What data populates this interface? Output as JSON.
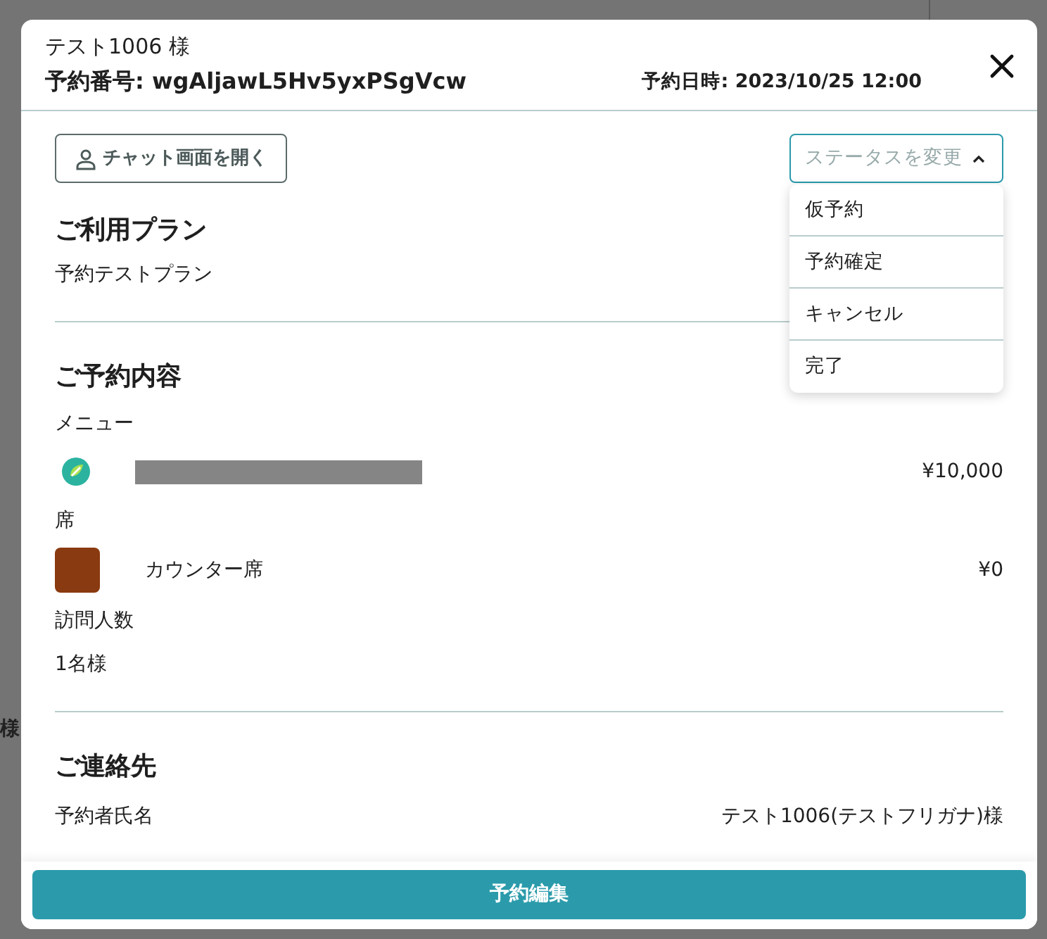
{
  "background": {
    "row_fragment": "様"
  },
  "modal": {
    "customer": "テスト1006 様",
    "reservation_number": "予約番号: wgAljawL5Hv5yxPSgVcw",
    "reservation_datetime": "予約日時: 2023/10/25 12:00"
  },
  "chat_button": "チャット画面を開く",
  "status_select": {
    "placeholder": "ステータスを変更",
    "expanded": true,
    "options": [
      {
        "label": "仮予約",
        "selected": false
      },
      {
        "label": "予約確定",
        "selected": false
      },
      {
        "label": "キャンセル",
        "selected": false
      },
      {
        "label": "完了",
        "selected": false
      }
    ]
  },
  "plan": {
    "heading": "ご利用プラン",
    "value": "予約テストプラン"
  },
  "details": {
    "heading": "ご予約内容",
    "menu_label": "メニュー",
    "menu_price": "¥10,000",
    "seat_label": "席",
    "seat_name": "カウンター席",
    "seat_price": "¥0",
    "visitors_label": "訪問人数",
    "visitors_value": "1名様"
  },
  "contact": {
    "heading": "ご連絡先",
    "rows": [
      {
        "label": "予約者氏名",
        "value": "テスト1006(テストフリガナ)様"
      }
    ]
  },
  "edit_button": "予約編集"
}
